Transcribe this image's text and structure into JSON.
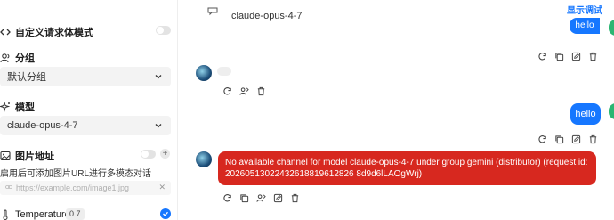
{
  "sidebar": {
    "custom_body_mode_label": "自定义请求体模式",
    "group_label": "分组",
    "group_value": "默认分组",
    "model_label": "模型",
    "model_value": "claude-opus-4-7",
    "image_label": "图片地址",
    "image_hint": "启用后可添加图片URL进行多模态对话",
    "image_url_placeholder": "https://example.com/image1.jpg",
    "temperature_label": "Temperature",
    "temperature_value": "0.7"
  },
  "chat": {
    "top_model": "claude-opus-4-7",
    "top_right_link": "显示调试",
    "top_hello": "hello",
    "user_message": "hello",
    "error_message": "No available channel for model claude-opus-4-7 under group gemini (distributor) (request id: 20260513022432618819612826 8d9d6lLAOgWrj)"
  },
  "colors": {
    "accent": "#1677ff",
    "error": "#d7281f",
    "online": "#2bb673"
  }
}
